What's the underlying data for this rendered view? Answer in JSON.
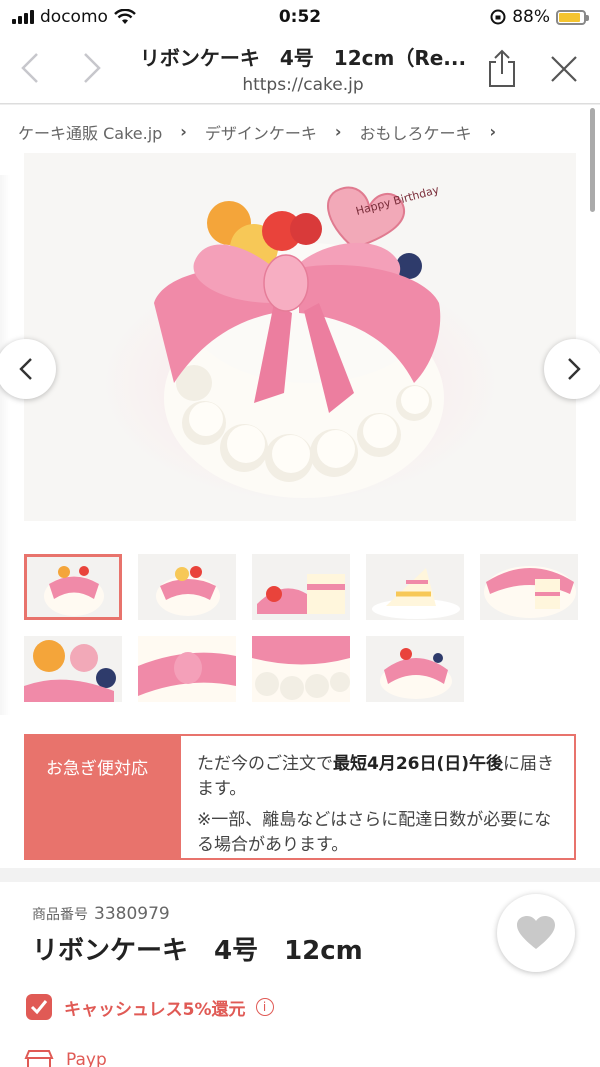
{
  "status": {
    "carrier": "docomo",
    "time": "0:52",
    "battery": "88%",
    "battery_level": 0.88
  },
  "navbar": {
    "title": "リボンケーキ　4号　12cm（Re...",
    "url": "https://cake.jp"
  },
  "breadcrumb": {
    "items": [
      "ケーキ通販 Cake.jp",
      "デザインケーキ",
      "おもしろケーキ"
    ]
  },
  "express": {
    "label": "お急ぎ便対応",
    "line_prefix": "ただ今のご注文で",
    "line_bold": "最短4月26日(日)午後",
    "line_suffix": "に届きます。",
    "note": "※一部、離島などはさらに配達日数が必要になる場合があります。"
  },
  "product": {
    "number_label": "商品番号",
    "number": "3380979",
    "name": "リボンケーキ　4号　12cm"
  },
  "cashless": {
    "text": "キャッシュレス5%還元",
    "info": "i"
  },
  "pay": {
    "text": "Payp"
  },
  "hero": {
    "plaque_text": "Happy Birthday"
  },
  "colors": {
    "accent": "#e8736c",
    "ribbon": "#f08aa8"
  }
}
